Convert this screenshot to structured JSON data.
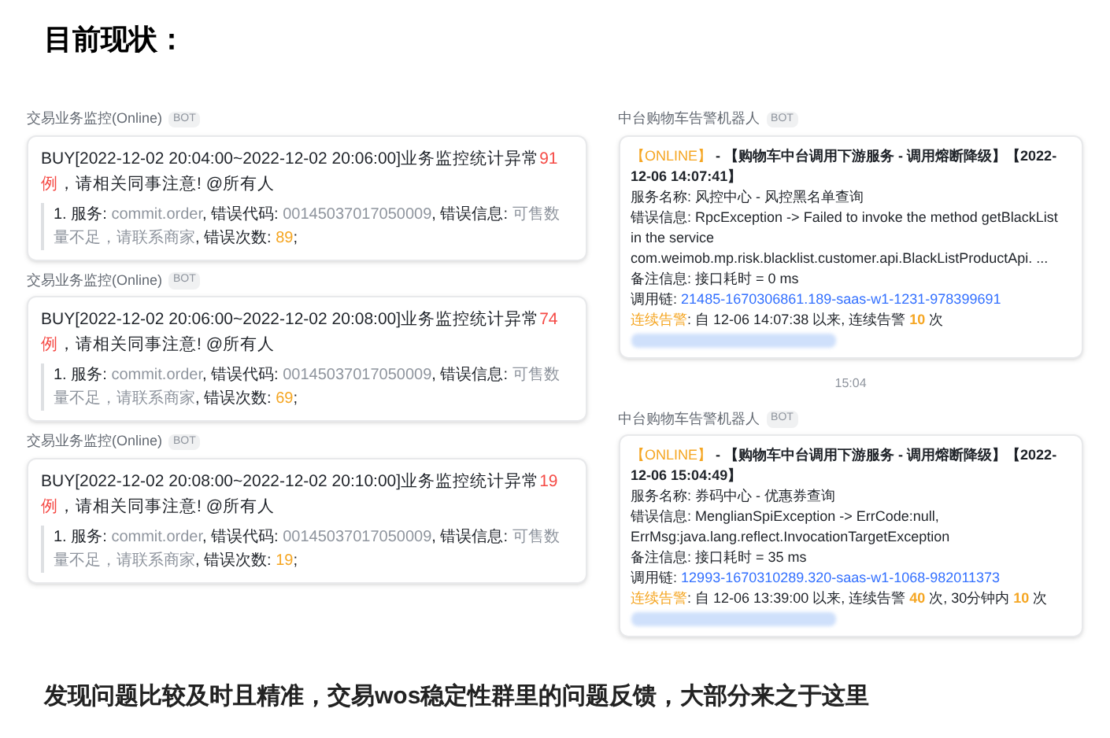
{
  "title": "目前现状：",
  "left_messages": [
    {
      "sender": "交易业务监控(Online)",
      "badge": "BOT",
      "paragraphs": [
        [
          {
            "kind": "plain",
            "text": "BUY[2022-12-02 20:04:00~2022-12-02 20:06:00]业务监控统计异常"
          },
          {
            "kind": "red",
            "text": "91例"
          },
          {
            "kind": "plain",
            "text": "，请相关同事注意! @所有人"
          }
        ]
      ],
      "detail": [
        {
          "kind": "plain",
          "text": "1. 服务: "
        },
        {
          "kind": "muted",
          "text": "commit.order"
        },
        {
          "kind": "plain",
          "text": ", 错误代码: "
        },
        {
          "kind": "muted",
          "text": "00145037017050009"
        },
        {
          "kind": "plain",
          "text": ", 错误信息: "
        },
        {
          "kind": "muted",
          "text": "可售数量不足，请联系商家"
        },
        {
          "kind": "plain",
          "text": ", 错误次数: "
        },
        {
          "kind": "orange",
          "text": "89"
        },
        {
          "kind": "plain",
          "text": ";"
        }
      ]
    },
    {
      "sender": "交易业务监控(Online)",
      "badge": "BOT",
      "paragraphs": [
        [
          {
            "kind": "plain",
            "text": "BUY[2022-12-02 20:06:00~2022-12-02 20:08:00]业务监控统计异常"
          },
          {
            "kind": "red",
            "text": "74例"
          },
          {
            "kind": "plain",
            "text": "，请相关同事注意! @所有人"
          }
        ]
      ],
      "detail": [
        {
          "kind": "plain",
          "text": "1. 服务: "
        },
        {
          "kind": "muted",
          "text": "commit.order"
        },
        {
          "kind": "plain",
          "text": ", 错误代码: "
        },
        {
          "kind": "muted",
          "text": "00145037017050009"
        },
        {
          "kind": "plain",
          "text": ", 错误信息: "
        },
        {
          "kind": "muted",
          "text": "可售数量不足，请联系商家"
        },
        {
          "kind": "plain",
          "text": ", 错误次数: "
        },
        {
          "kind": "orange",
          "text": "69"
        },
        {
          "kind": "plain",
          "text": ";"
        }
      ]
    },
    {
      "sender": "交易业务监控(Online)",
      "badge": "BOT",
      "paragraphs": [
        [
          {
            "kind": "plain",
            "text": "BUY[2022-12-02 20:08:00~2022-12-02 20:10:00]业务监控统计异常"
          },
          {
            "kind": "red",
            "text": "19例"
          },
          {
            "kind": "plain",
            "text": "，请相关同事注意! @所有人"
          }
        ]
      ],
      "detail": [
        {
          "kind": "plain",
          "text": "1. 服务: "
        },
        {
          "kind": "muted",
          "text": "commit.order"
        },
        {
          "kind": "plain",
          "text": ", 错误代码: "
        },
        {
          "kind": "muted",
          "text": "00145037017050009"
        },
        {
          "kind": "plain",
          "text": ", 错误信息: "
        },
        {
          "kind": "muted",
          "text": "可售数量不足，请联系商家"
        },
        {
          "kind": "plain",
          "text": ", 错误次数: "
        },
        {
          "kind": "orange",
          "text": "19"
        },
        {
          "kind": "plain",
          "text": ";"
        }
      ]
    }
  ],
  "right_messages": [
    {
      "sender": "中台购物车告警机器人",
      "badge": "BOT",
      "paragraphs": [
        [
          {
            "kind": "orange",
            "text": "【ONLINE】"
          },
          {
            "kind": "bold",
            "text": " - 【购物车中台调用下游服务 - 调用熔断降级】【2022-12-06 14:07:41】"
          }
        ],
        [
          {
            "kind": "plain",
            "text": "服务名称: 风控中心 - 风控黑名单查询"
          }
        ],
        [
          {
            "kind": "plain",
            "text": "错误信息: RpcException -> Failed to invoke the method getBlackList in the service com.weimob.mp.risk.blacklist.customer.api.BlackListProductApi. ..."
          }
        ],
        [
          {
            "kind": "plain",
            "text": "备注信息: 接口耗时 = 0 ms"
          }
        ],
        [
          {
            "kind": "plain",
            "text": "调用链: "
          },
          {
            "kind": "link",
            "text": "21485-1670306861.189-saas-w1-1231-978399691"
          }
        ],
        [
          {
            "kind": "orange",
            "text": "连续告警"
          },
          {
            "kind": "plain",
            "text": ": 自 12-06 14:07:38 以来, 连续告警 "
          },
          {
            "kind": "orangebold",
            "text": "10"
          },
          {
            "kind": "plain",
            "text": " 次"
          }
        ]
      ]
    },
    {
      "time": "15:04"
    },
    {
      "sender": "中台购物车告警机器人",
      "badge": "BOT",
      "paragraphs": [
        [
          {
            "kind": "orange",
            "text": "【ONLINE】"
          },
          {
            "kind": "bold",
            "text": " - 【购物车中台调用下游服务 - 调用熔断降级】【2022-12-06 15:04:49】"
          }
        ],
        [
          {
            "kind": "plain",
            "text": "服务名称: 券码中心 - 优惠券查询"
          }
        ],
        [
          {
            "kind": "plain",
            "text": "错误信息: MenglianSpiException -> ErrCode:null, ErrMsg:java.lang.reflect.InvocationTargetException"
          }
        ],
        [
          {
            "kind": "plain",
            "text": "备注信息: 接口耗时 = 35 ms"
          }
        ],
        [
          {
            "kind": "plain",
            "text": "调用链: "
          },
          {
            "kind": "link",
            "text": "12993-1670310289.320-saas-w1-1068-982011373"
          }
        ],
        [
          {
            "kind": "orange",
            "text": "连续告警"
          },
          {
            "kind": "plain",
            "text": ": 自 12-06 13:39:00 以来, 连续告警 "
          },
          {
            "kind": "orangebold",
            "text": "40"
          },
          {
            "kind": "plain",
            "text": " 次, 30分钟内 "
          },
          {
            "kind": "orangebold",
            "text": "10"
          },
          {
            "kind": "plain",
            "text": " 次"
          }
        ]
      ]
    }
  ],
  "conclusion": "发现问题比较及时且精准，交易wos稳定性群里的问题反馈，大部分来之于这里"
}
